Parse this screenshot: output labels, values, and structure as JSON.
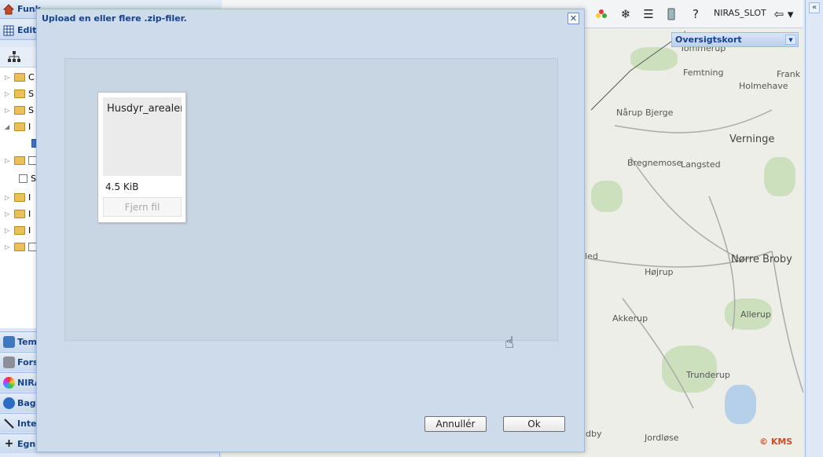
{
  "left_panel": {
    "funk_header": "Funk",
    "edit_header": "Edit",
    "tree_rows": [
      "C",
      "S",
      "S",
      "I",
      "S",
      "I",
      "I",
      "I",
      ""
    ],
    "accordion": [
      {
        "label": "Tem",
        "icon": "globe-icon"
      },
      {
        "label": "Fors",
        "icon": "tools-icon"
      },
      {
        "label": "NIRA",
        "icon": "color-wheel-icon"
      },
      {
        "label": "Bagg",
        "icon": "world-icon"
      },
      {
        "label": "Inte",
        "icon": "measure-icon"
      },
      {
        "label": "Egn",
        "icon": "plus-icon"
      }
    ]
  },
  "toolbar": {
    "user": "NIRAS_SLOT",
    "icons": [
      "flower-icon",
      "snowflake-icon",
      "list-icon",
      "phone-icon",
      "help-icon",
      "logout-icon"
    ]
  },
  "map": {
    "overview_select": "Oversigtskort",
    "places": [
      {
        "name": "Tommerup",
        "big": false
      },
      {
        "name": "Femtning",
        "big": false
      },
      {
        "name": "Frank",
        "big": false
      },
      {
        "name": "Holmehave",
        "big": false
      },
      {
        "name": "Nårup Bjerge",
        "big": false
      },
      {
        "name": "Verninge",
        "big": true
      },
      {
        "name": "Bregnemose",
        "big": false
      },
      {
        "name": "Langsted",
        "big": false
      },
      {
        "name": "Nørre Broby",
        "big": true
      },
      {
        "name": "led",
        "big": false
      },
      {
        "name": "Højrup",
        "big": false
      },
      {
        "name": "Akkerup",
        "big": false
      },
      {
        "name": "Allerup",
        "big": false
      },
      {
        "name": "Trunderup",
        "big": false
      },
      {
        "name": "Jordløse",
        "big": false
      },
      {
        "name": "dby",
        "big": false
      }
    ],
    "attribution": "© KMS"
  },
  "modal": {
    "title": "Upload en eller flere .zip-filer.",
    "close_icon": "close-icon",
    "file": {
      "name": "Husdyr_arealer",
      "size": "4.5 KiB",
      "remove_label": "Fjern fil"
    },
    "cancel_label": "Annullér",
    "ok_label": "Ok"
  }
}
